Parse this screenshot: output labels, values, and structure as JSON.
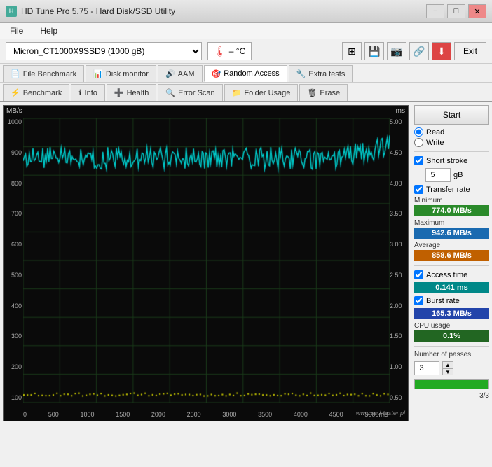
{
  "window": {
    "title": "HD Tune Pro 5.75 - Hard Disk/SSD Utility",
    "controls": [
      "−",
      "□",
      "✕"
    ]
  },
  "menu": {
    "items": [
      "File",
      "Help"
    ]
  },
  "toolbar": {
    "disk_label": "Micron_CT1000X9SSD9 (1000 gB)",
    "temp_value": "– °C",
    "exit_label": "Exit"
  },
  "tabs_row1": [
    {
      "label": "File Benchmark",
      "icon": "📄"
    },
    {
      "label": "Disk monitor",
      "icon": "📊"
    },
    {
      "label": "AAM",
      "icon": "🔊"
    },
    {
      "label": "Random Access",
      "icon": "🎯",
      "active": true
    },
    {
      "label": "Extra tests",
      "icon": "🔧"
    }
  ],
  "tabs_row2": [
    {
      "label": "Benchmark",
      "icon": "⚡"
    },
    {
      "label": "Info",
      "icon": "ℹ"
    },
    {
      "label": "Health",
      "icon": "➕"
    },
    {
      "label": "Error Scan",
      "icon": "🔍"
    },
    {
      "label": "Folder Usage",
      "icon": "📁"
    },
    {
      "label": "Erase",
      "icon": "🗑"
    }
  ],
  "chart": {
    "y_left_label": "MB/s",
    "y_right_label": "ms",
    "y_left_values": [
      "1000",
      "900",
      "800",
      "700",
      "600",
      "500",
      "400",
      "300",
      "200",
      "100"
    ],
    "y_right_values": [
      "5.00",
      "4.50",
      "4.00",
      "3.50",
      "3.00",
      "2.50",
      "2.00",
      "1.50",
      "1.00",
      "0.50"
    ],
    "x_values": [
      "0",
      "500",
      "1000",
      "1500",
      "2000",
      "2500",
      "3000",
      "3500",
      "4000",
      "4500",
      "5000mB"
    ],
    "watermark": "www.ssd-tester.pl"
  },
  "controls": {
    "start_label": "Start",
    "read_label": "Read",
    "write_label": "Write",
    "short_stroke_label": "Short stroke",
    "short_stroke_checked": true,
    "short_stroke_value": "5",
    "short_stroke_unit": "gB",
    "transfer_rate_label": "Transfer rate",
    "transfer_rate_checked": true,
    "minimum_label": "Minimum",
    "minimum_value": "774.0 MB/s",
    "maximum_label": "Maximum",
    "maximum_value": "942.6 MB/s",
    "average_label": "Average",
    "average_value": "858.6 MB/s",
    "access_time_label": "Access time",
    "access_time_checked": true,
    "access_time_value": "0.141 ms",
    "burst_rate_label": "Burst rate",
    "burst_rate_checked": true,
    "burst_rate_value": "165.3 MB/s",
    "cpu_usage_label": "CPU usage",
    "cpu_usage_value": "0.1%",
    "passes_label": "Number of passes",
    "passes_value": "3",
    "passes_progress": "3/3",
    "passes_percent": 100
  }
}
